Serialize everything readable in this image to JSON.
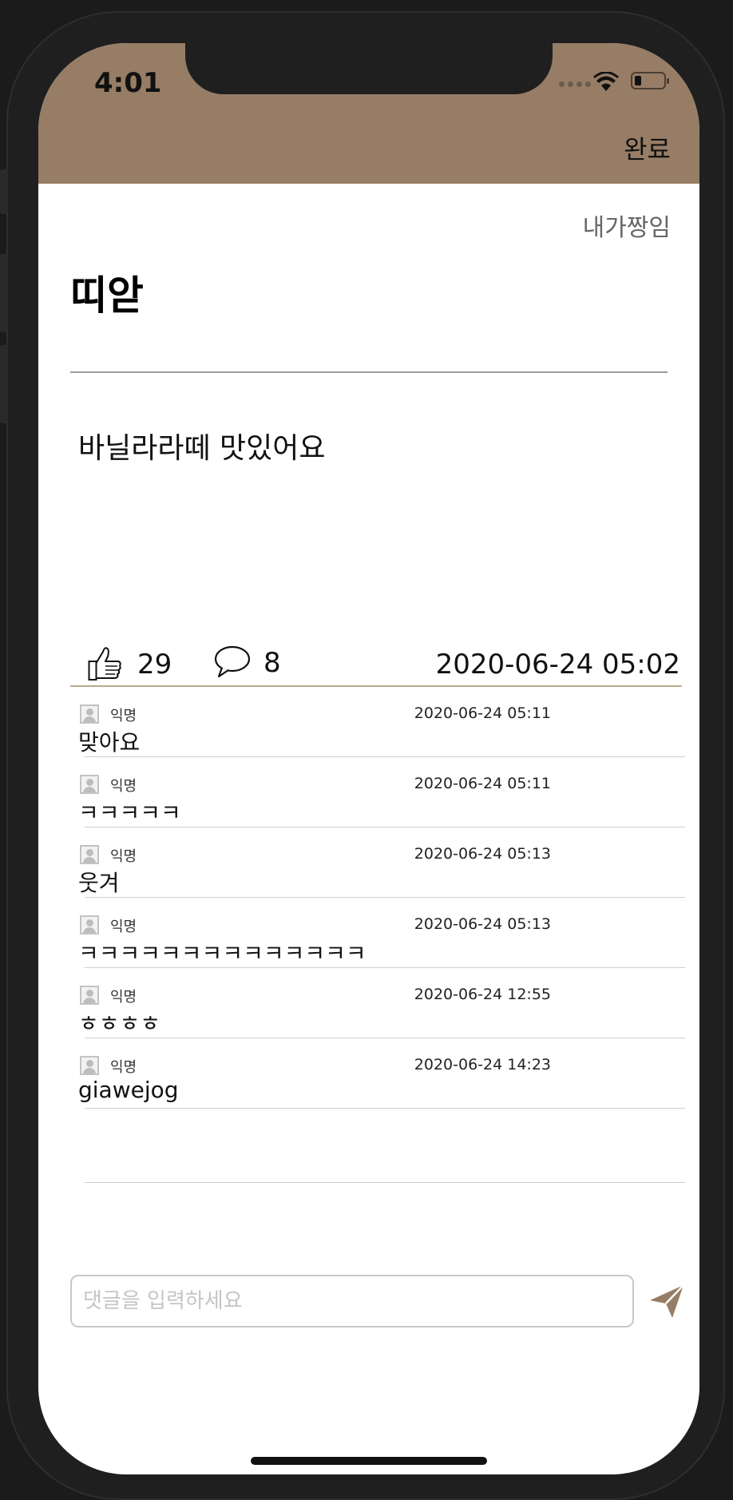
{
  "status_bar": {
    "time": "4:01"
  },
  "nav": {
    "done_label": "완료"
  },
  "post": {
    "author": "내가짱임",
    "title": "띠앋",
    "content": "바닐라라떼 맛있어요",
    "like_count": "29",
    "comment_count": "8",
    "date": "2020-06-24 05:02"
  },
  "comments": [
    {
      "author": "익명",
      "date": "2020-06-24 05:11",
      "text": "맞아요"
    },
    {
      "author": "익명",
      "date": "2020-06-24 05:11",
      "text": "ㅋㅋㅋㅋㅋ"
    },
    {
      "author": "익명",
      "date": "2020-06-24 05:13",
      "text": "웃겨"
    },
    {
      "author": "익명",
      "date": "2020-06-24 05:13",
      "text": "ㅋㅋㅋㅋㅋㅋㅋㅋㅋㅋㅋㅋㅋㅋ"
    },
    {
      "author": "익명",
      "date": "2020-06-24 12:55",
      "text": "ㅎㅎㅎㅎ"
    },
    {
      "author": "익명",
      "date": "2020-06-24 14:23",
      "text": "giawejog"
    }
  ],
  "comment_input": {
    "placeholder": "댓글을 입력하세요",
    "value": ""
  },
  "colors": {
    "header": "#977d65",
    "accent": "#977d65",
    "stats_divider": "#b6ab86"
  },
  "icons": {
    "like": "thumbs-up-icon",
    "comment": "speech-bubble-icon",
    "send": "paper-plane-icon",
    "avatar": "person-placeholder-icon"
  }
}
